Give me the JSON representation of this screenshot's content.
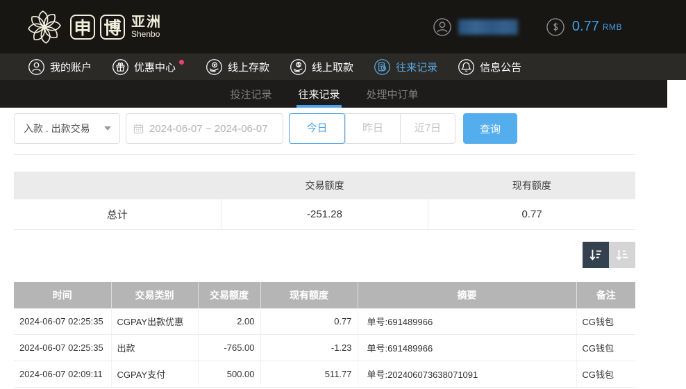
{
  "header": {
    "logo": {
      "char1": "申",
      "char2": "博",
      "region": "亚洲",
      "subtitle": "Shenbo"
    },
    "balance": {
      "amount": "0.77",
      "currency": "RMB"
    }
  },
  "nav": {
    "items": [
      {
        "label": "我的账户",
        "icon": "user-icon"
      },
      {
        "label": "优惠中心",
        "icon": "gift-icon",
        "has_new_badge": true
      },
      {
        "label": "线上存款",
        "icon": "deposit-icon"
      },
      {
        "label": "线上取款",
        "icon": "withdraw-icon"
      },
      {
        "label": "往来记录",
        "icon": "records-icon",
        "active": true
      },
      {
        "label": "信息公告",
        "icon": "announcement-icon"
      }
    ]
  },
  "tabs": {
    "items": [
      {
        "label": "投注记录"
      },
      {
        "label": "往来记录",
        "active": true
      },
      {
        "label": "处理中订单"
      }
    ]
  },
  "filters": {
    "type_select": {
      "value": "入款 . 出款交易"
    },
    "date_range": {
      "value": "2024-06-07 ~ 2024-06-07"
    },
    "quick_ranges": [
      {
        "label": "今日",
        "active": true
      },
      {
        "label": "昨日",
        "active": false
      },
      {
        "label": "近7日",
        "active": false
      }
    ],
    "search_button": "查询"
  },
  "summary": {
    "col_transaction": "交易额度",
    "col_balance": "现有额度",
    "total_label": "总计",
    "total_transaction": "-251.28",
    "total_balance": "0.77"
  },
  "records": {
    "headers": [
      "时间",
      "交易类别",
      "交易额度",
      "现有额度",
      "摘要",
      "备注"
    ],
    "rows": [
      {
        "time": "2024-06-07 02:25:35",
        "type": "CGPAY出款优惠",
        "amount": "2.00",
        "balance": "0.77",
        "summary": "单号:691489966",
        "note": "CG钱包"
      },
      {
        "time": "2024-06-07 02:25:35",
        "type": "出款",
        "amount": "-765.00",
        "balance": "-1.23",
        "summary": "单号:691489966",
        "note": "CG钱包"
      },
      {
        "time": "2024-06-07 02:09:11",
        "type": "CGPAY支付",
        "amount": "500.00",
        "balance": "511.77",
        "summary": "单号:202406073638071091",
        "note": "CG钱包"
      }
    ]
  },
  "colors": {
    "accent_blue": "#4da3e8",
    "balance_blue": "#3e9de8",
    "search_button_blue": "#54adec",
    "notification_red": "#e8436f",
    "logo_cream": "#f1efdc",
    "topbar_bg": "#171613",
    "nav_bg": "#2b2a27",
    "subtab_bg": "#1d1c1a",
    "summary_header_bg": "#ebebeb",
    "table_header_bg": "#b5b5b5",
    "sort_active_bg": "#344250",
    "sort_inactive_bg": "#d5d5d5"
  }
}
